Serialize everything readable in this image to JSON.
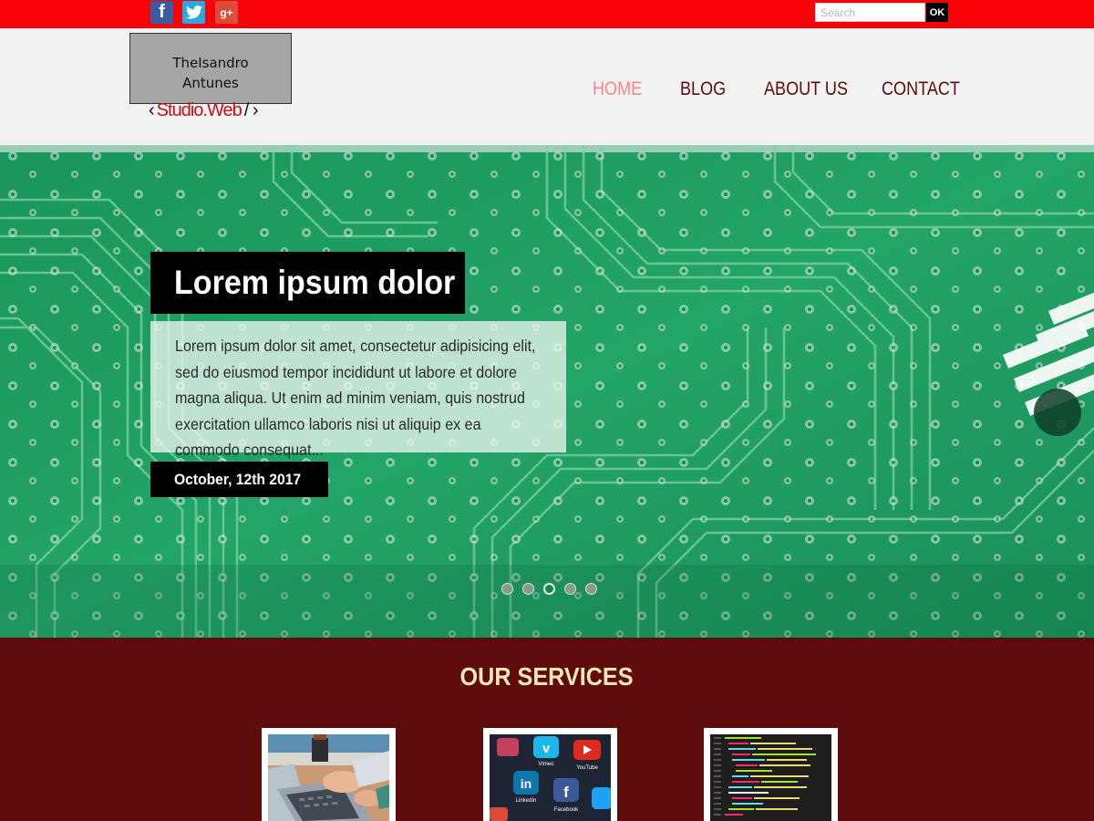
{
  "topbar": {
    "social": [
      {
        "name": "facebook",
        "glyph": "f"
      },
      {
        "name": "twitter",
        "glyph": "t"
      },
      {
        "name": "google-plus",
        "glyph": "g+"
      }
    ],
    "search_placeholder": "Search",
    "search_button": "OK",
    "background_color": "#fa0007"
  },
  "header": {
    "logo_line1": "TheIsandro",
    "logo_line2": "Antunes",
    "logo_sub_left": "‹",
    "logo_sub_studio": "Studio.Web",
    "logo_sub_right": "/ ›"
  },
  "nav": {
    "items": [
      {
        "label": "HOME",
        "active": true
      },
      {
        "label": "BLOG",
        "active": false
      },
      {
        "label": "ABOUT US",
        "active": false
      },
      {
        "label": "CONTACT",
        "active": false
      }
    ]
  },
  "hero": {
    "title": "Lorem ipsum dolor",
    "body": "Lorem ipsum dolor sit amet, consectetur adipisicing elit, sed do eiusmod tempor incididunt ut labore et dolore magna aliqua. Ut enim ad minim veniam, quis nostrud exercitation ullamco laboris nisi ut aliquip ex ea commodo consequat...",
    "date": "October, 12th 2017",
    "slide_count": 5,
    "active_slide": 3
  },
  "services": {
    "title": "OUR SERVICES",
    "background_color": "#5e0b0c",
    "cards": [
      {
        "image": "laptop-typing-photo"
      },
      {
        "image": "social-media-apps-photo",
        "app_labels": [
          "Vimeo",
          "YouTube",
          "LinkedIn",
          "Facebook"
        ]
      },
      {
        "image": "code-editor-photo"
      }
    ]
  }
}
